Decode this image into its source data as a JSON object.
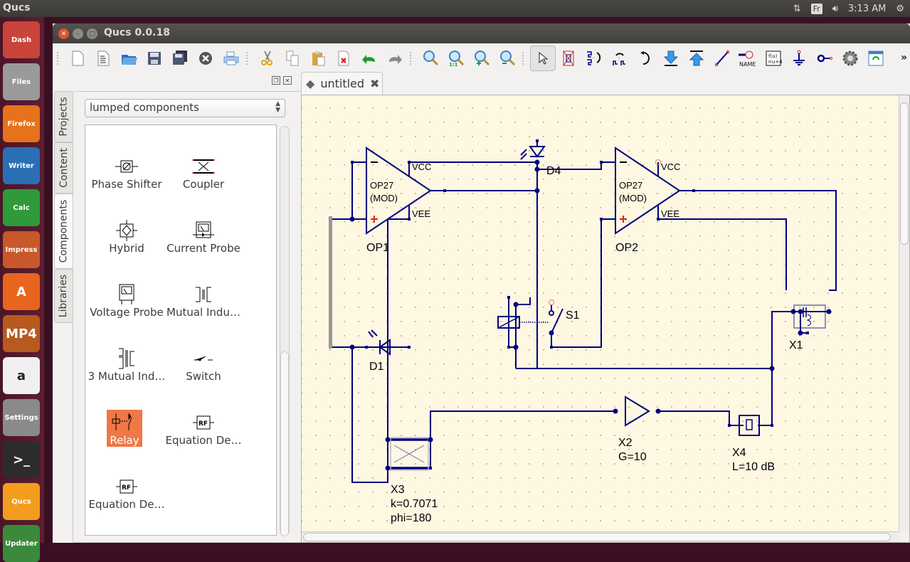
{
  "system": {
    "app_name": "Qucs",
    "keyboard_layout": "Fr",
    "clock": "3:13 AM"
  },
  "launcher": {
    "items": [
      {
        "name": "ubuntu-dash",
        "label": "Dash",
        "color": "#c9443a"
      },
      {
        "name": "files",
        "label": "Files",
        "color": "#9a9a98"
      },
      {
        "name": "firefox",
        "label": "Firefox",
        "color": "#e8711b"
      },
      {
        "name": "libreoffice-writer",
        "label": "Writer",
        "color": "#2a6fb4"
      },
      {
        "name": "libreoffice-calc",
        "label": "Calc",
        "color": "#2f9a3a"
      },
      {
        "name": "libreoffice-impress",
        "label": "Impress",
        "color": "#c8582a"
      },
      {
        "name": "software-center",
        "label": "A",
        "color": "#e8651f"
      },
      {
        "name": "mp4-player",
        "label": "MP4",
        "color": "#b85a1f"
      },
      {
        "name": "amazon",
        "label": "a",
        "color": "#f0f0f0"
      },
      {
        "name": "system-settings",
        "label": "Settings",
        "color": "#8a8a88"
      },
      {
        "name": "terminal",
        "label": ">_",
        "color": "#2c2c2c"
      },
      {
        "name": "qucs",
        "label": "Qucs",
        "color": "#f29d1e"
      },
      {
        "name": "software-updater",
        "label": "Updater",
        "color": "#3b8a3b"
      }
    ]
  },
  "window": {
    "title": "Qucs 0.0.18"
  },
  "toolbar": {
    "buttons": [
      "new",
      "new-text",
      "open",
      "save",
      "save-all",
      "close",
      "print",
      "cut",
      "copy",
      "paste",
      "delete",
      "undo",
      "redo",
      "zoom-fit",
      "zoom-1to1",
      "zoom-in",
      "zoom-out",
      "select",
      "deactivate",
      "mirror-x",
      "mirror-y",
      "rotate",
      "enter-subcircuit",
      "exit-subcircuit",
      "wire",
      "wire-label",
      "equation",
      "ground",
      "port",
      "simulate",
      "view-data"
    ],
    "name_label": "NAME",
    "equation_label": "f(u)=u+4",
    "more_label": "»"
  },
  "dock": {
    "tabs": [
      "Projects",
      "Content",
      "Components",
      "Libraries"
    ],
    "active_tab": "Components",
    "category": "lumped components",
    "components": [
      {
        "label": "Phase Shifter",
        "icon": "phase-shifter"
      },
      {
        "label": "Coupler",
        "icon": "coupler"
      },
      {
        "label": "Hybrid",
        "icon": "hybrid"
      },
      {
        "label": "Current Probe",
        "icon": "current-probe"
      },
      {
        "label": "Voltage Probe",
        "icon": "voltage-probe"
      },
      {
        "label": "Mutual Indu…",
        "icon": "mutual-inductor"
      },
      {
        "label": "3 Mutual Ind…",
        "icon": "three-mutual-inductors"
      },
      {
        "label": "Switch",
        "icon": "switch"
      },
      {
        "label": "Relay",
        "icon": "relay",
        "selected": true
      },
      {
        "label": "Equation De…",
        "icon": "rf-equation"
      },
      {
        "label": "Equation De…",
        "icon": "rf-equation"
      }
    ]
  },
  "document": {
    "tab_label": "untitled",
    "wire_color": "#000080",
    "components": {
      "op1": {
        "name": "OP1",
        "model": "OP27",
        "model2": "(MOD)",
        "vcc": "VCC",
        "vee": "VEE"
      },
      "op2": {
        "name": "OP2",
        "model": "OP27",
        "model2": "(MOD)",
        "vcc": "VCC",
        "vee": "VEE"
      },
      "d4": {
        "name": "D4"
      },
      "d1": {
        "name": "D1"
      },
      "s1": {
        "name": "S1"
      },
      "x1": {
        "name": "X1"
      },
      "x2": {
        "name": "X2",
        "param": "G=10"
      },
      "x3": {
        "name": "X3",
        "param1": "k=0.7071",
        "param2": "phi=180"
      },
      "x4": {
        "name": "X4",
        "param": "L=10 dB"
      }
    }
  }
}
